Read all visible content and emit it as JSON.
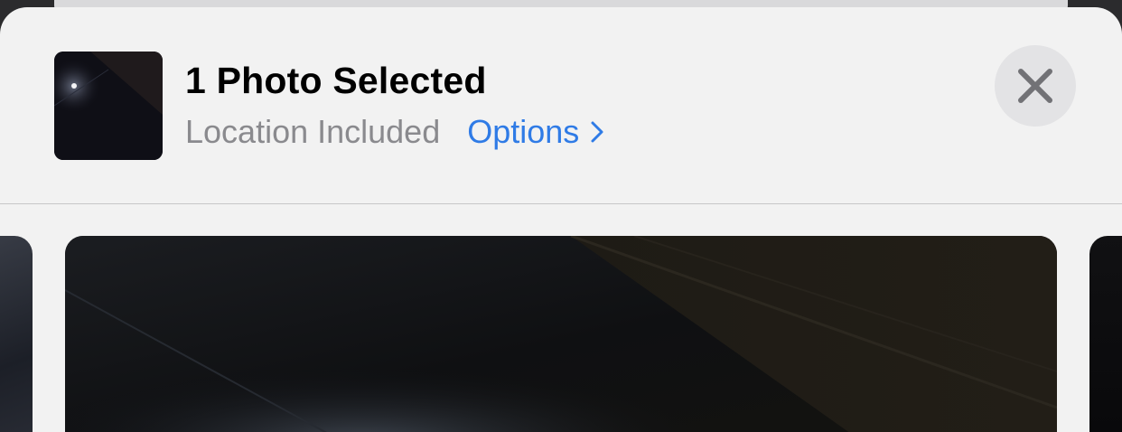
{
  "share_sheet": {
    "title": "1 Photo Selected",
    "location_status": "Location Included",
    "options_label": "Options",
    "options_chevron_icon": "chevron-right-icon",
    "close_icon": "xmark-icon"
  },
  "colors": {
    "sheet_background": "#f2f2f2",
    "options_link": "#2f7be6",
    "secondary_text": "#8a8a8e",
    "close_button_fill": "#e3e3e5"
  },
  "carousel": {
    "selected_index": 1,
    "photo_count_visible": 3
  }
}
